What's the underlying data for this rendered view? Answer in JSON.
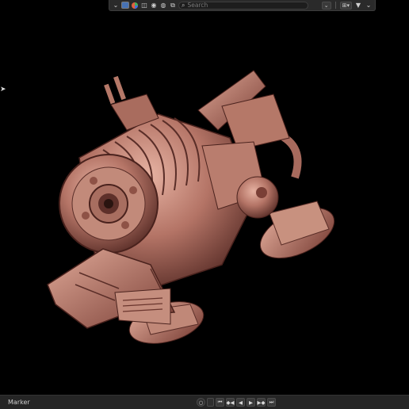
{
  "header": {
    "search_placeholder": "Search",
    "icons": [
      "chevron-down-icon",
      "view-layer-icon",
      "globe-icon",
      "filter-toggle-icon",
      "sort-icon",
      "dropdown-icon",
      "funnel-icon"
    ]
  },
  "timeline": {
    "marker_label": "Marker",
    "controls": [
      "record",
      "jump-start",
      "jump-prev-keyframe",
      "play-reverse",
      "play",
      "jump-next-keyframe",
      "jump-end"
    ]
  },
  "colors": {
    "model_base": "#b87a6c",
    "model_shadow": "#5a2e28",
    "model_highlight": "#e8b8a8",
    "viewport_bg": "#000000"
  }
}
